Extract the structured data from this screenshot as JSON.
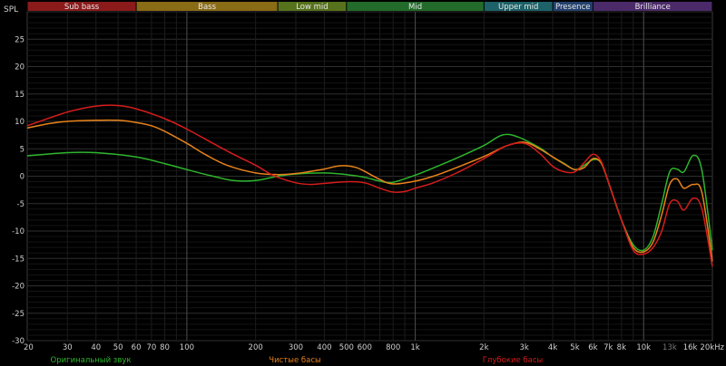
{
  "chart_data": {
    "type": "line",
    "x_scale": "log",
    "xlim": [
      20,
      20000
    ],
    "ylim": [
      -30,
      30
    ],
    "ylabel": "SPL",
    "grid": true,
    "background": "#000000",
    "x_ticks": [
      {
        "f": 20,
        "label": "20",
        "major": false
      },
      {
        "f": 30,
        "label": "30",
        "major": false
      },
      {
        "f": 40,
        "label": "40",
        "major": false
      },
      {
        "f": 50,
        "label": "50",
        "major": false
      },
      {
        "f": 60,
        "label": "60",
        "major": false
      },
      {
        "f": 70,
        "label": "70",
        "major": false
      },
      {
        "f": 80,
        "label": "80",
        "major": false
      },
      {
        "f": 100,
        "label": "100",
        "major": true
      },
      {
        "f": 200,
        "label": "200",
        "major": false
      },
      {
        "f": 300,
        "label": "300",
        "major": false
      },
      {
        "f": 400,
        "label": "400",
        "major": false
      },
      {
        "f": 500,
        "label": "500",
        "major": false
      },
      {
        "f": 600,
        "label": "600",
        "major": false
      },
      {
        "f": 800,
        "label": "800",
        "major": false
      },
      {
        "f": 1000,
        "label": "1k",
        "major": true
      },
      {
        "f": 2000,
        "label": "2k",
        "major": false
      },
      {
        "f": 3000,
        "label": "3k",
        "major": false
      },
      {
        "f": 4000,
        "label": "4k",
        "major": false
      },
      {
        "f": 5000,
        "label": "5k",
        "major": false
      },
      {
        "f": 6000,
        "label": "6k",
        "major": false
      },
      {
        "f": 7000,
        "label": "7k",
        "major": false
      },
      {
        "f": 8000,
        "label": "8k",
        "major": false
      },
      {
        "f": 10000,
        "label": "10k",
        "major": true
      },
      {
        "f": 13000,
        "label": "13k",
        "major": false,
        "dim": true
      },
      {
        "f": 16000,
        "label": "16k",
        "major": false
      },
      {
        "f": 20000,
        "label": "20kHz",
        "major": false
      }
    ],
    "y_ticks": [
      25,
      20,
      15,
      10,
      5,
      0,
      -5,
      -10,
      -15,
      -20,
      -25,
      -30
    ],
    "bands": [
      {
        "label": "Sub bass",
        "from": 20,
        "to": 60,
        "color": "#8b1a1a"
      },
      {
        "label": "Bass",
        "from": 60,
        "to": 250,
        "color": "#8a6b16"
      },
      {
        "label": "Low mid",
        "from": 250,
        "to": 500,
        "color": "#57721c"
      },
      {
        "label": "Mid",
        "from": 500,
        "to": 2000,
        "color": "#226b2a"
      },
      {
        "label": "Upper mid",
        "from": 2000,
        "to": 4000,
        "color": "#1d6268"
      },
      {
        "label": "Presence",
        "from": 4000,
        "to": 6000,
        "color": "#23406e"
      },
      {
        "label": "Brilliance",
        "from": 6000,
        "to": 20000,
        "color": "#4b2a6a"
      }
    ],
    "series": [
      {
        "name": "Оригинальный звук",
        "color": "#2db52d",
        "points": [
          [
            20,
            3.7
          ],
          [
            30,
            4.3
          ],
          [
            40,
            4.3
          ],
          [
            60,
            3.5
          ],
          [
            80,
            2.3
          ],
          [
            100,
            1.2
          ],
          [
            130,
            0
          ],
          [
            160,
            -0.8
          ],
          [
            200,
            -0.8
          ],
          [
            250,
            0
          ],
          [
            300,
            0.4
          ],
          [
            400,
            0.6
          ],
          [
            500,
            0.3
          ],
          [
            600,
            -0.2
          ],
          [
            700,
            -0.9
          ],
          [
            800,
            -1.1
          ],
          [
            1000,
            0.2
          ],
          [
            1200,
            1.5
          ],
          [
            1500,
            3.2
          ],
          [
            2000,
            5.6
          ],
          [
            2400,
            7.5
          ],
          [
            2800,
            7.2
          ],
          [
            3500,
            5.2
          ],
          [
            4000,
            3.5
          ],
          [
            4500,
            2.3
          ],
          [
            5000,
            1.2
          ],
          [
            5500,
            2.0
          ],
          [
            6000,
            3.0
          ],
          [
            6500,
            2.5
          ],
          [
            7000,
            -1
          ],
          [
            8000,
            -8
          ],
          [
            9000,
            -12.5
          ],
          [
            10000,
            -13.5
          ],
          [
            11000,
            -11
          ],
          [
            12000,
            -5
          ],
          [
            13000,
            0.8
          ],
          [
            14000,
            1.3
          ],
          [
            15000,
            0.8
          ],
          [
            16500,
            3.8
          ],
          [
            18000,
            1
          ],
          [
            20000,
            -13.5
          ]
        ]
      },
      {
        "name": "Чистые басы",
        "color": "#e8821a",
        "points": [
          [
            20,
            8.8
          ],
          [
            25,
            9.6
          ],
          [
            30,
            10.0
          ],
          [
            40,
            10.2
          ],
          [
            50,
            10.2
          ],
          [
            60,
            9.8
          ],
          [
            70,
            9.2
          ],
          [
            80,
            8.2
          ],
          [
            100,
            6.0
          ],
          [
            120,
            4.0
          ],
          [
            150,
            2.0
          ],
          [
            200,
            0.6
          ],
          [
            250,
            0.3
          ],
          [
            300,
            0.5
          ],
          [
            350,
            0.9
          ],
          [
            400,
            1.3
          ],
          [
            450,
            1.8
          ],
          [
            500,
            1.9
          ],
          [
            550,
            1.6
          ],
          [
            600,
            0.9
          ],
          [
            700,
            -0.6
          ],
          [
            800,
            -1.4
          ],
          [
            1000,
            -0.9
          ],
          [
            1200,
            0
          ],
          [
            1500,
            1.5
          ],
          [
            2000,
            3.6
          ],
          [
            2500,
            5.5
          ],
          [
            3000,
            6.2
          ],
          [
            3500,
            5.0
          ],
          [
            4000,
            3.5
          ],
          [
            4500,
            2.2
          ],
          [
            5000,
            1.2
          ],
          [
            5500,
            1.6
          ],
          [
            6000,
            3.2
          ],
          [
            6500,
            2.5
          ],
          [
            7000,
            -1
          ],
          [
            8000,
            -8
          ],
          [
            9000,
            -13
          ],
          [
            10000,
            -13.8
          ],
          [
            11000,
            -12
          ],
          [
            12000,
            -7
          ],
          [
            13000,
            -1.5
          ],
          [
            14000,
            -0.5
          ],
          [
            15000,
            -2.2
          ],
          [
            16500,
            -1.5
          ],
          [
            18000,
            -3
          ],
          [
            20000,
            -15.5
          ]
        ]
      },
      {
        "name": "Глубокие басы",
        "color": "#d61c1c",
        "points": [
          [
            20,
            9.2
          ],
          [
            30,
            11.7
          ],
          [
            40,
            12.8
          ],
          [
            50,
            12.9
          ],
          [
            60,
            12.3
          ],
          [
            80,
            10.5
          ],
          [
            100,
            8.6
          ],
          [
            130,
            6.0
          ],
          [
            160,
            4.0
          ],
          [
            200,
            2.0
          ],
          [
            230,
            0.5
          ],
          [
            250,
            -0.2
          ],
          [
            300,
            -1.2
          ],
          [
            350,
            -1.5
          ],
          [
            400,
            -1.3
          ],
          [
            500,
            -1.0
          ],
          [
            600,
            -1.2
          ],
          [
            700,
            -2.2
          ],
          [
            800,
            -2.9
          ],
          [
            900,
            -2.8
          ],
          [
            1000,
            -2.2
          ],
          [
            1200,
            -1.2
          ],
          [
            1500,
            0.5
          ],
          [
            2000,
            3.2
          ],
          [
            2500,
            5.5
          ],
          [
            3000,
            6.0
          ],
          [
            3500,
            4.2
          ],
          [
            4000,
            1.8
          ],
          [
            4500,
            0.8
          ],
          [
            5000,
            0.8
          ],
          [
            5500,
            2.5
          ],
          [
            6000,
            4.0
          ],
          [
            6500,
            2.8
          ],
          [
            7000,
            -1
          ],
          [
            8000,
            -8
          ],
          [
            9000,
            -13.5
          ],
          [
            10000,
            -14.2
          ],
          [
            11000,
            -13
          ],
          [
            12000,
            -10
          ],
          [
            13000,
            -5
          ],
          [
            14000,
            -4.5
          ],
          [
            15000,
            -6.2
          ],
          [
            16500,
            -4
          ],
          [
            18000,
            -6
          ],
          [
            20000,
            -16.5
          ]
        ]
      }
    ]
  }
}
